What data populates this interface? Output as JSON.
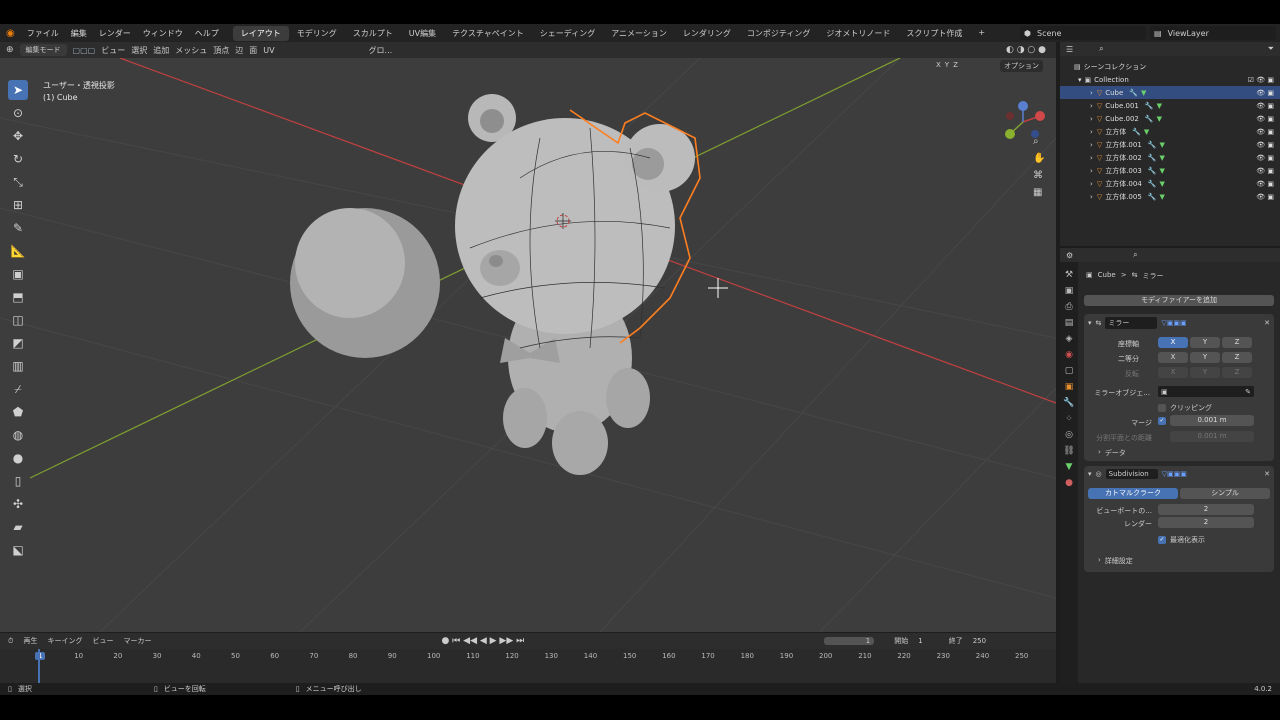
{
  "menu": {
    "file": "ファイル",
    "edit": "編集",
    "render": "レンダー",
    "window": "ウィンドウ",
    "help": "ヘルプ"
  },
  "workspaces": [
    "レイアウト",
    "モデリング",
    "スカルプト",
    "UV編集",
    "テクスチャペイント",
    "シェーディング",
    "アニメーション",
    "レンダリング",
    "コンポジティング",
    "ジオメトリノード",
    "スクリプト作成"
  ],
  "workspace_add": "+",
  "scene": "Scene",
  "view_layer": "ViewLayer",
  "viewport": {
    "mode": "編集モード",
    "menu_items": [
      "ビュー",
      "選択",
      "追加",
      "メッシュ",
      "頂点",
      "辺",
      "面",
      "UV"
    ],
    "orientation": "グロ...",
    "view_name": "ユーザー・透視投影",
    "object_name": "(1) Cube",
    "axes": [
      "X",
      "Y",
      "Z"
    ],
    "options": "オプション"
  },
  "outliner": {
    "scene_collection": "シーンコレクション",
    "collection": "Collection",
    "items": [
      "Cube",
      "Cube.001",
      "Cube.002",
      "立方体",
      "立方体.001",
      "立方体.002",
      "立方体.003",
      "立方体.004",
      "立方体.005"
    ]
  },
  "properties": {
    "breadcrumb_object": "Cube",
    "breadcrumb_sep": ">",
    "breadcrumb_modifier": "ミラー",
    "add_modifier": "モディファイアーを追加",
    "mirror": {
      "name": "ミラー",
      "axis_label": "座標軸",
      "bisect_label": "二等分",
      "flip_label": "反転",
      "x": "X",
      "y": "Y",
      "z": "Z",
      "mirror_object_label": "ミラーオブジェ...",
      "clipping_label": "クリッピング",
      "merge_label": "マージ",
      "merge_value": "0.001 m",
      "bisect_distance_label": "分割平面との距離",
      "bisect_distance_value": "0.001 m",
      "data_label": "データ"
    },
    "subdivision": {
      "name": "Subdivision",
      "catmull": "カトマルクラーク",
      "simple": "シンプル",
      "viewport_label": "ビューポートの...",
      "viewport_value": "2",
      "render_label": "レンダー",
      "render_value": "2",
      "optimal_label": "最適化表示",
      "advanced_label": "詳細設定"
    }
  },
  "timeline": {
    "playback": "再生",
    "keying": "キーイング",
    "view": "ビュー",
    "marker": "マーカー",
    "current_frame": "1",
    "start_label": "開始",
    "start_value": "1",
    "end_label": "終了",
    "end_value": "250",
    "ticks": [
      "1",
      "10",
      "20",
      "30",
      "40",
      "50",
      "60",
      "70",
      "80",
      "90",
      "100",
      "110",
      "120",
      "130",
      "140",
      "150",
      "160",
      "170",
      "180",
      "190",
      "200",
      "210",
      "220",
      "230",
      "240",
      "250"
    ]
  },
  "status": {
    "select": "選択",
    "rotate_view": "ビューを回転",
    "call_menu": "メニュー呼び出し",
    "version": "4.0.2"
  },
  "colors": {
    "accent": "#4772b3",
    "selection": "#ff7f20",
    "x_axis": "#c04040",
    "y_axis": "#7fa030"
  }
}
